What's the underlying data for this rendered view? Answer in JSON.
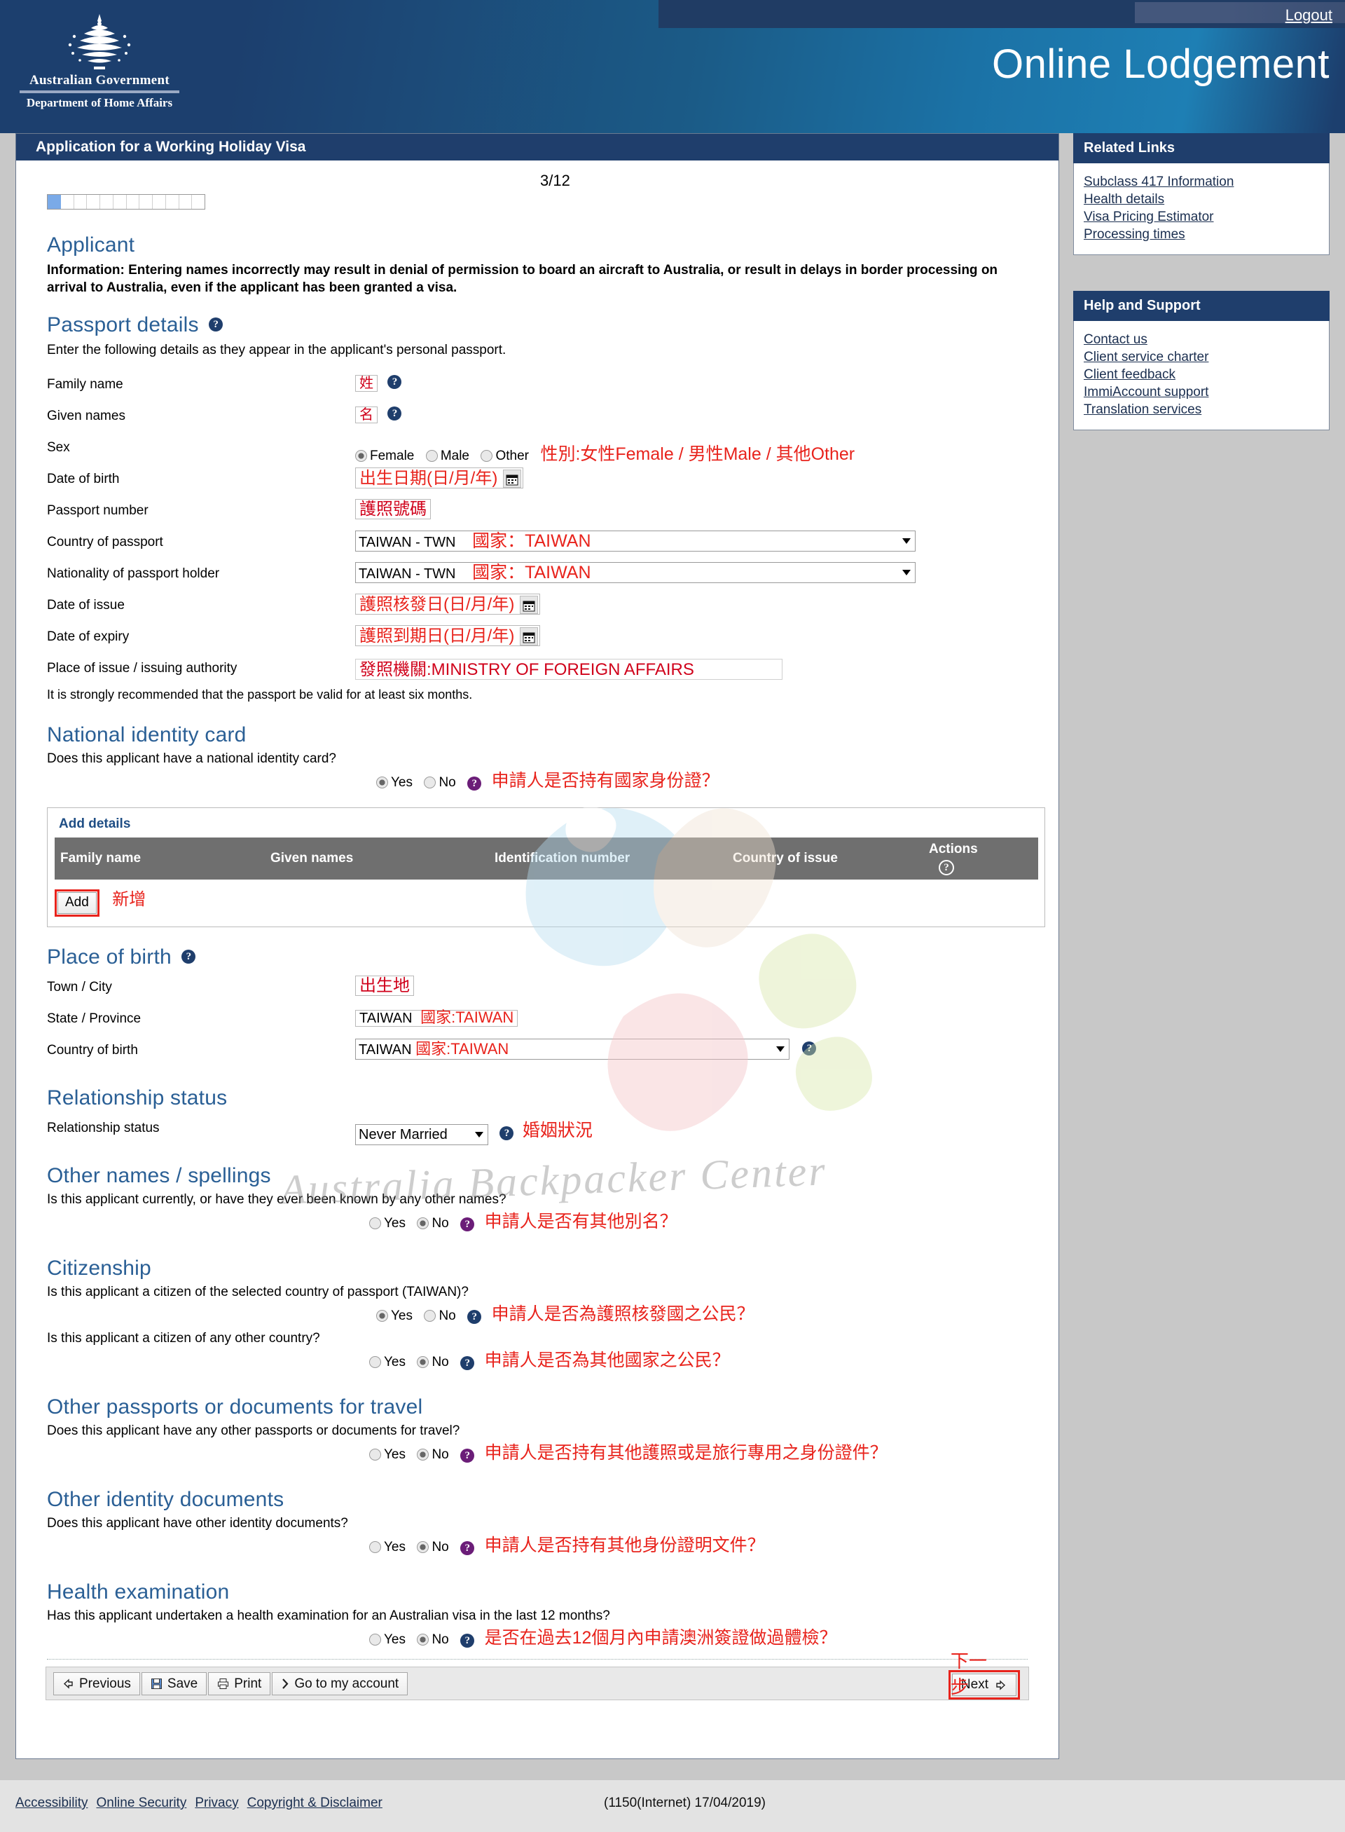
{
  "header": {
    "logout_label": "Logout",
    "crest_line1": "Australian Government",
    "crest_line2": "Department of Home Affairs",
    "app_title": "Online Lodgement"
  },
  "panel": {
    "title": "Application for a Working Holiday Visa",
    "step_label": "3/12",
    "progress": {
      "total_segments": 12,
      "filled_segments": 1
    }
  },
  "applicant": {
    "heading": "Applicant",
    "information": "Information: Entering names incorrectly may result in denial of permission to board an aircraft to Australia, or result in delays in border processing on arrival to Australia, even if the applicant has been granted a visa."
  },
  "passport_details": {
    "heading": "Passport details",
    "subtext": "Enter the following details as they appear in the applicant's personal passport.",
    "fields": {
      "family_name_label": "Family name",
      "family_name_value": "姓",
      "given_names_label": "Given names",
      "given_names_value": "名",
      "sex_label": "Sex",
      "sex_options": [
        "Female",
        "Male",
        "Other"
      ],
      "sex_selected": "Female",
      "sex_annotation": "性別:女性Female / 男性Male / 其他Other",
      "dob_label": "Date of birth",
      "dob_value": "出生日期(日/月/年)",
      "passport_number_label": "Passport number",
      "passport_number_value": "護照號碼",
      "country_of_passport_label": "Country of passport",
      "country_of_passport_value": "TAIWAN - TWN",
      "country_of_passport_annotation": "國家：TAIWAN",
      "nationality_label": "Nationality of passport holder",
      "nationality_value": "TAIWAN - TWN",
      "nationality_annotation": "國家：TAIWAN",
      "date_of_issue_label": "Date of issue",
      "date_of_issue_value": "護照核發日(日/月/年)",
      "date_of_expiry_label": "Date of expiry",
      "date_of_expiry_value": "護照到期日(日/月/年)",
      "place_of_issue_label": "Place of issue / issuing authority",
      "place_of_issue_value": "發照機關:MINISTRY OF FOREIGN AFFAIRS",
      "validity_note": "It is strongly recommended that the passport be valid for at least six months."
    }
  },
  "national_identity_card": {
    "heading": "National identity card",
    "question": "Does this applicant have a national identity card?",
    "yes_label": "Yes",
    "no_label": "No",
    "selected": "Yes",
    "annotation": "申請人是否持有國家身份證？",
    "add_details_label": "Add details",
    "columns": [
      "Family name",
      "Given names",
      "Identification number",
      "Country of issue",
      "Actions"
    ],
    "rows": [],
    "add_button_label": "Add",
    "add_annotation": "新增"
  },
  "place_of_birth": {
    "heading": "Place of birth",
    "town_label": "Town / City",
    "town_value": "出生地",
    "state_label": "State / Province",
    "state_value": "TAIWAN",
    "state_annotation": "國家:TAIWAN",
    "country_label": "Country of birth",
    "country_value": "TAIWAN",
    "country_annotation": "國家:TAIWAN"
  },
  "relationship_status": {
    "heading": "Relationship status",
    "label": "Relationship status",
    "value": "Never Married",
    "annotation": "婚姻狀況"
  },
  "other_names": {
    "heading": "Other names / spellings",
    "question": "Is this applicant currently, or have they ever been known by any other names?",
    "yes_label": "Yes",
    "no_label": "No",
    "selected": "No",
    "annotation": "申請人是否有其他別名？"
  },
  "citizenship": {
    "heading": "Citizenship",
    "question1": "Is this applicant a citizen of the selected country of passport (TAIWAN)?",
    "selected1": "Yes",
    "annotation1": "申請人是否為護照核發國之公民？",
    "question2": "Is this applicant a citizen of any other country?",
    "selected2": "No",
    "annotation2": "申請人是否為其他國家之公民？",
    "yes_label": "Yes",
    "no_label": "No"
  },
  "other_passports": {
    "heading": "Other passports or documents for travel",
    "question": "Does this applicant have any other passports or documents for travel?",
    "yes_label": "Yes",
    "no_label": "No",
    "selected": "No",
    "annotation": "申請人是否持有其他護照或是旅行專用之身份證件？"
  },
  "other_identity_documents": {
    "heading": "Other identity documents",
    "question": "Does this applicant have other identity documents?",
    "yes_label": "Yes",
    "no_label": "No",
    "selected": "No",
    "annotation": "申請人是否持有其他身份證明文件？"
  },
  "health_examination": {
    "heading": "Health examination",
    "question": "Has this applicant undertaken a health examination for an Australian visa in the last 12 months?",
    "yes_label": "Yes",
    "no_label": "No",
    "selected": "No",
    "annotation": "是否在過去12個月內申請澳洲簽證做過體檢？"
  },
  "toolbar": {
    "previous_label": "Previous",
    "save_label": "Save",
    "print_label": "Print",
    "account_label": "Go to my account",
    "next_label": "Next",
    "next_annotation": "下一步"
  },
  "sidebar": {
    "related_links_title": "Related Links",
    "related_links": [
      "Subclass 417 Information",
      "Health details",
      "Visa Pricing Estimator",
      "Processing times"
    ],
    "help_title": "Help and Support",
    "help_links": [
      "Contact us",
      "Client service charter",
      "Client feedback",
      "ImmiAccount support",
      "Translation services"
    ]
  },
  "footer": {
    "links": [
      "Accessibility",
      "Online Security",
      "Privacy",
      "Copyright & Disclaimer"
    ],
    "version": "(1150(Internet) 17/04/2019)"
  },
  "watermark": {
    "text": "Australia Backpacker Center"
  }
}
